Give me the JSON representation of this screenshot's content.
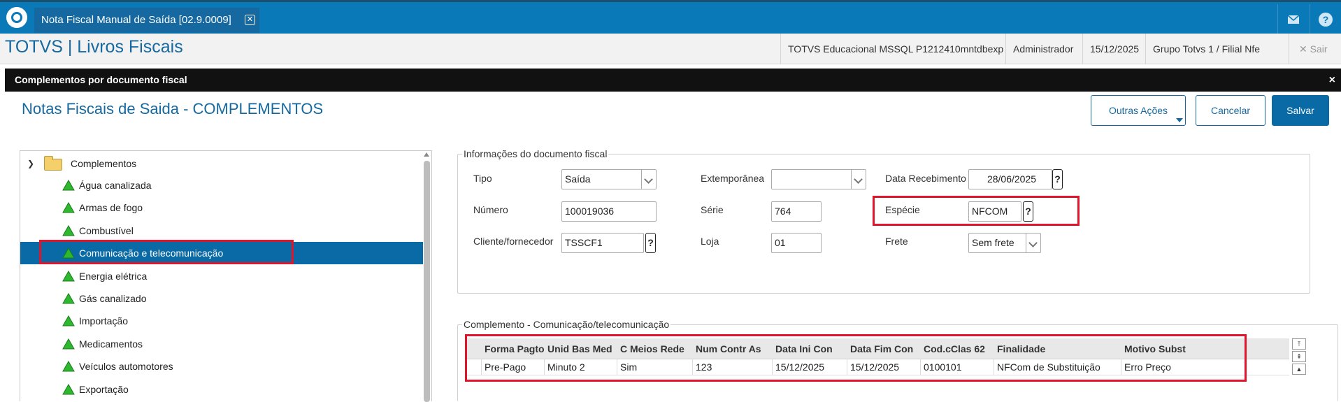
{
  "top": {
    "tab_label": "Nota Fiscal Manual de Saída [02.9.0009]",
    "tab_close": "✕",
    "mail_icon": "mail-icon",
    "help_label": "?"
  },
  "infobar": {
    "brand": "TOTVS | Livros Fiscais",
    "environment": "TOTVS Educacional MSSQL P1212410mntdbexp",
    "user": "Administrador",
    "date": "15/12/2025",
    "branch": "Grupo Totvs 1 / Filial Nfe",
    "exit_label": "✕  Sair"
  },
  "modal": {
    "header": "Complementos por documento fiscal",
    "close": "×",
    "title": "Notas Fiscais de Saida - COMPLEMENTOS",
    "btn_other": "Outras Ações",
    "btn_cancel": "Cancelar",
    "btn_save": "Salvar"
  },
  "tree": {
    "root": "Complementos",
    "items": [
      "Água canalizada",
      "Armas de fogo",
      "Combustível",
      "Comunicação e telecomunicação",
      "Energia elétrica",
      "Gás canalizado",
      "Importação",
      "Medicamentos",
      "Veículos automotores",
      "Exportação"
    ]
  },
  "doc": {
    "legend": "Informações do documento fiscal",
    "tipo_label": "Tipo",
    "tipo_value": "Saída",
    "extemp_label": "Extemporânea",
    "extemp_value": "",
    "data_rec_label": "Data Recebimento",
    "data_rec_value": "28/06/2025",
    "numero_label": "Número",
    "numero_value": "100019036",
    "serie_label": "Série",
    "serie_value": "764",
    "especie_label": "Espécie",
    "especie_value": "NFCOM",
    "cliente_label": "Cliente/fornecedor",
    "cliente_value": "TSSCF1",
    "loja_label": "Loja",
    "loja_value": "01",
    "frete_label": "Frete",
    "frete_value": "Sem frete",
    "lookup": "?"
  },
  "complemento": {
    "legend": "Complemento - Comunicação/telecomunicação",
    "columns": [
      "Forma Pagto",
      "Unid Bas Med",
      "C Meios Rede",
      "Num Contr As",
      "Data Ini Con",
      "Data Fim Con",
      "Cod.cClas 62",
      "Finalidade",
      "Motivo Subst"
    ],
    "rows": [
      [
        "Pre-Pago",
        "Minuto 2",
        "Sim",
        "123",
        "15/12/2025",
        "15/12/2025",
        "0100101",
        "NFCom de Substituição",
        "Erro Preço"
      ]
    ],
    "nav_first": "⤒",
    "nav_prev": "⇞",
    "nav_up": "▲"
  },
  "colors": {
    "accent": "#0a79b8",
    "highlight": "#e0142b",
    "tree_icon": "#2eb82e"
  }
}
